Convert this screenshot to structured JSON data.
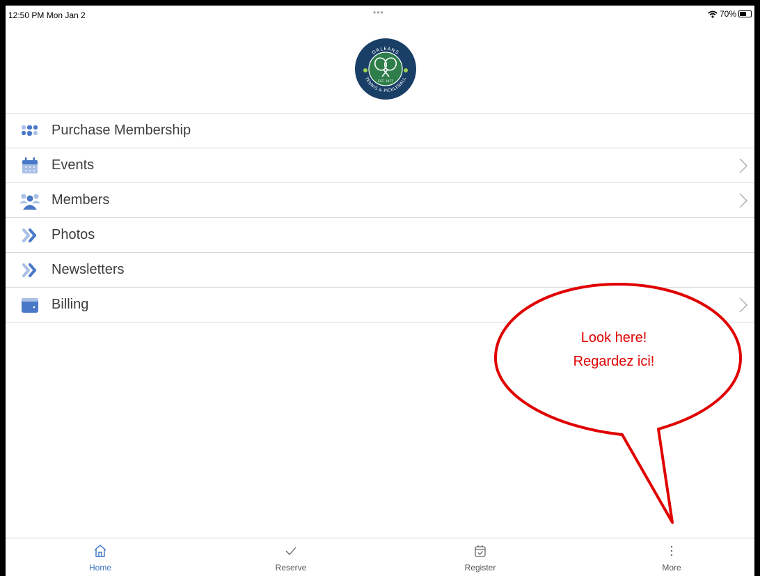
{
  "status_bar": {
    "time": "12:50 PM  Mon Jan 2",
    "dots": "•••",
    "battery": "70%",
    "battery_level": 0.7
  },
  "header": {
    "logo_top_text": "ORLEANS",
    "logo_est_text": "EST. 1977",
    "logo_bottom_text": "TENNIS & PICKLEBALL"
  },
  "menu": {
    "items": [
      {
        "label": "Purchase Membership",
        "icon": "grid-dots-icon",
        "has_chevron": false
      },
      {
        "label": "Events",
        "icon": "calendar-icon",
        "has_chevron": true
      },
      {
        "label": "Members",
        "icon": "people-icon",
        "has_chevron": true
      },
      {
        "label": "Photos",
        "icon": "double-chevron-icon",
        "has_chevron": false
      },
      {
        "label": "Newsletters",
        "icon": "double-chevron-icon",
        "has_chevron": false
      },
      {
        "label": "Billing",
        "icon": "wallet-icon",
        "has_chevron": true
      }
    ]
  },
  "callout": {
    "line1": "Look here!",
    "line2": "Regardez ici!"
  },
  "tab_bar": {
    "tabs": [
      {
        "label": "Home",
        "icon": "home-icon",
        "active": true
      },
      {
        "label": "Reserve",
        "icon": "check-icon",
        "active": false
      },
      {
        "label": "Register",
        "icon": "calendar-check-icon",
        "active": false
      },
      {
        "label": "More",
        "icon": "more-vertical-icon",
        "active": false
      }
    ]
  },
  "colors": {
    "accent": "#3b73c2",
    "icon_blue": "#4a78c8",
    "icon_light": "#a8bfe6",
    "callout_red": "#e00000",
    "logo_navy": "#1a3f66",
    "logo_green": "#2e7d4a"
  }
}
